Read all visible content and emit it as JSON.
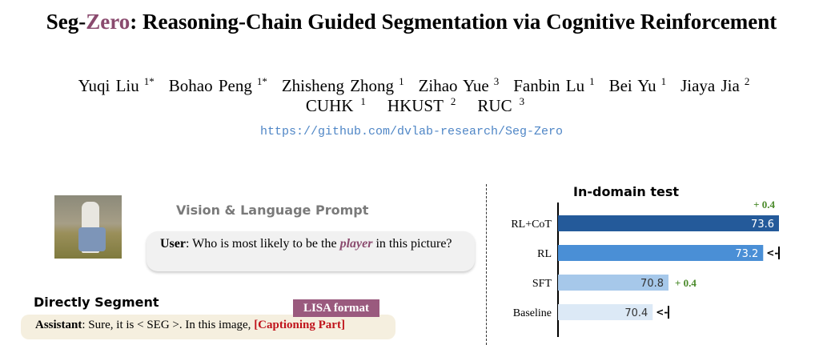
{
  "title": {
    "prefix": "Seg-",
    "highlight": "Zero",
    "rest": ": Reasoning-Chain Guided Segmentation via Cognitive Reinforcement"
  },
  "authors": [
    {
      "name": "Yuqi Liu",
      "sup": "1*"
    },
    {
      "name": "Bohao Peng",
      "sup": "1*"
    },
    {
      "name": "Zhisheng Zhong",
      "sup": "1"
    },
    {
      "name": "Zihao Yue",
      "sup": "3"
    },
    {
      "name": "Fanbin Lu",
      "sup": "1"
    },
    {
      "name": "Bei Yu",
      "sup": "1"
    },
    {
      "name": "Jiaya Jia",
      "sup": "2"
    }
  ],
  "affiliations": [
    {
      "name": "CUHK",
      "sup": "1"
    },
    {
      "name": "HKUST",
      "sup": "2"
    },
    {
      "name": "RUC",
      "sup": "3"
    }
  ],
  "url": "https://github.com/dvlab-research/Seg-Zero",
  "figure": {
    "prompt_heading": "Vision & Language Prompt",
    "user_label": "User",
    "user_pre": ": Who is most likely to be the ",
    "user_keyword": "player",
    "user_post": " in this picture?",
    "direct_heading": "Directly Segment",
    "lisa_tag": "LISA format",
    "assistant_label": "Assistant",
    "assistant_text": ": Sure, it is < SEG >. In this image, ",
    "assistant_caption": "[Captioning Part]"
  },
  "chart_data": {
    "type": "bar",
    "orientation": "horizontal",
    "title": "In-domain test",
    "categories": [
      "RL+CoT",
      "RL",
      "SFT",
      "Baseline"
    ],
    "values": [
      73.6,
      73.2,
      70.8,
      70.4
    ],
    "value_labels": [
      "73.6",
      "73.2",
      "70.8",
      "70.4"
    ],
    "colors": [
      "#245a9a",
      "#4a8fd6",
      "#a6c8ea",
      "#dce9f6"
    ],
    "label_colors": [
      "#ffffff",
      "#ffffff",
      "#333333",
      "#333333"
    ],
    "annotations": [
      {
        "text": "+ 0.4",
        "near": "RL+CoT",
        "color": "#4a8a2a"
      },
      {
        "text": "+ 0.4",
        "near": "SFT",
        "color": "#4a8a2a"
      }
    ],
    "xlim": [
      68,
      73.6
    ]
  }
}
